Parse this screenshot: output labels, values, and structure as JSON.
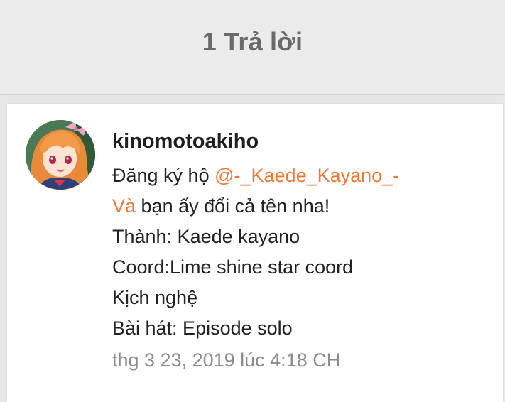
{
  "header": {
    "title": "1 Trả lời"
  },
  "comment": {
    "username": "kinomotoakiho",
    "avatar_icon": "anime-girl-avatar-icon",
    "line1_prefix": "Đăng ký hộ ",
    "mention": "@-_Kaede_Kayano_-",
    "line2_link": "Và",
    "line2_rest": " bạn ấy đổi cả tên nha!",
    "line3": "Thành: Kaede kayano",
    "line4": "Coord:Lime shine star coord",
    "line5": "Kịch nghệ",
    "line6": "Bài hát: Episode solo",
    "timestamp": "thg 3 23, 2019 lúc 4:18 CH"
  },
  "colors": {
    "mention": "#f07832",
    "header_text": "#6a6a6a",
    "timestamp": "#8b8b8b"
  }
}
